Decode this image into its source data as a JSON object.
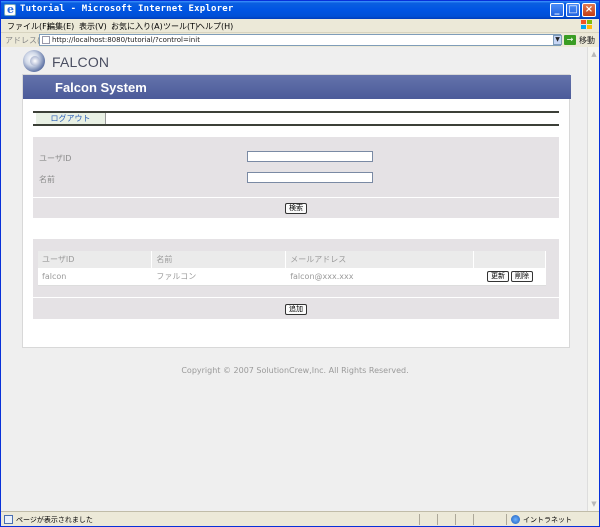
{
  "window": {
    "title": "Tutorial - Microsoft Internet Explorer",
    "minimize_glyph": "_",
    "maximize_glyph": "□",
    "close_glyph": "×"
  },
  "menu": [
    "ファイル(F)",
    "編集(E)",
    "表示(V)",
    "お気に入り(A)",
    "ツール(T)",
    "ヘルプ(H)"
  ],
  "address_bar": {
    "label": "アドレス(D)",
    "url": "http://localhost:8080/tutorial/?control=init",
    "go_label": "移動",
    "go_glyph": "→",
    "dropdown_glyph": "▼"
  },
  "logo": {
    "text": "FALCON"
  },
  "header": {
    "title": "Falcon System"
  },
  "nav": {
    "logout": "ログアウト"
  },
  "search_form": {
    "user_id_label": "ユーザID",
    "user_id_value": "",
    "name_label": "名前",
    "name_value": "",
    "search_button": "検索"
  },
  "user_table": {
    "columns": [
      "ユーザID",
      "名前",
      "メールアドレス",
      ""
    ],
    "rows": [
      {
        "user_id": "falcon",
        "name": "ファルコン",
        "email": "falcon@xxx.xxx",
        "update_button": "更新",
        "delete_button": "削除"
      }
    ],
    "add_button": "追加"
  },
  "footer": {
    "copyright": "Copyright © 2007 SolutionCrew,Inc. All Rights Reserved."
  },
  "scrollbar": {
    "up_glyph": "▲",
    "down_glyph": "▼"
  },
  "status_bar": {
    "message": "ページが表示されました",
    "zone": "イントラネット"
  }
}
